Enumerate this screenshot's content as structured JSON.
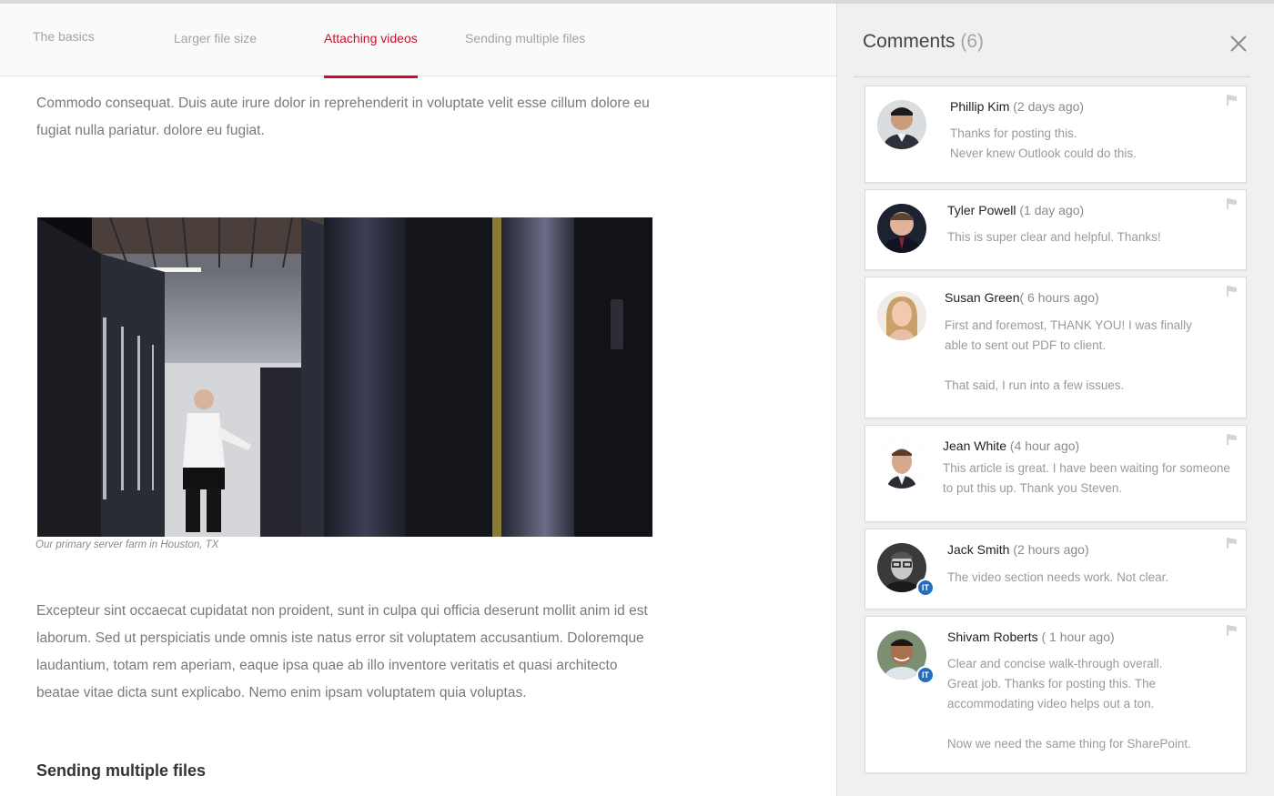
{
  "tabs": [
    {
      "label": "The basics",
      "active": false
    },
    {
      "label": "Larger file size",
      "active": false
    },
    {
      "label": "Attaching videos",
      "active": true
    },
    {
      "label": "Sending multiple files",
      "active": false
    }
  ],
  "article": {
    "paragraph_1": "Commodo consequat. Duis aute irure dolor in reprehenderit in voluptate velit esse cillum dolore eu fugiat nulla pariatur. dolore eu fugiat.",
    "image_caption": "Our primary server farm in Houston, TX",
    "paragraph_2": "Excepteur sint occaecat cupidatat non proident, sunt in culpa qui officia deserunt mollit anim id est laborum. Sed ut perspiciatis unde omnis iste natus error sit voluptatem accusantium. Doloremque laudantium, totam rem aperiam, eaque ipsa quae ab illo inventore veritatis et quasi architecto beatae vitae dicta sunt explicabo. Nemo enim ipsam voluptatem quia voluptas.",
    "section_heading": "Sending multiple files"
  },
  "comments": {
    "title": "Comments",
    "count": "(6)",
    "items": [
      {
        "name": "Phillip Kim",
        "time": " (2 days ago)",
        "lines": [
          "Thanks for posting this.",
          "Never knew Outlook could do this."
        ],
        "badge": ""
      },
      {
        "name": "Tyler Powell",
        "time": " (1 day ago)",
        "lines": [
          "This is super clear and helpful. Thanks!"
        ],
        "badge": ""
      },
      {
        "name": "Susan Green",
        "time": "( 6 hours ago)",
        "lines": [
          "First and foremost, THANK YOU! I was finally",
          "able to sent out PDF to client.",
          "",
          "That said, I run into a few issues."
        ],
        "badge": ""
      },
      {
        "name": "Jean White",
        "time": " (4 hour ago)",
        "lines": [
          "This article is great. I have been waiting for someone",
          "to put this up. Thank you Steven."
        ],
        "badge": ""
      },
      {
        "name": "Jack Smith",
        "time": " (2 hours ago)",
        "lines": [
          "The video section needs work. Not clear."
        ],
        "badge": "IT"
      },
      {
        "name": "Shivam Roberts",
        "time": " ( 1 hour ago)",
        "lines": [
          "Clear and concise walk-through overall.",
          "Great job. Thanks for posting this. The",
          "accommodating video helps out a ton.",
          "",
          "Now we need the same thing for SharePoint."
        ],
        "badge": "IT"
      }
    ]
  },
  "colors": {
    "accent": "#c8102e",
    "badge": "#1f6fc6"
  },
  "icons": {
    "close": "close-icon",
    "flag": "flag-icon"
  }
}
